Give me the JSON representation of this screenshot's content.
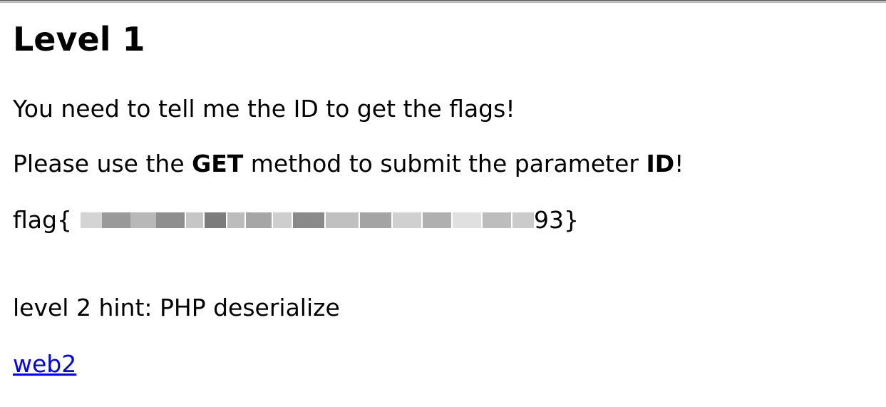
{
  "heading": "Level 1",
  "intro": "You need to tell me the ID to get the flags!",
  "instruction": {
    "prefix": "Please use the ",
    "method": "GET",
    "middle": " method to submit the parameter ",
    "param": "ID",
    "suffix": "!"
  },
  "flag": {
    "prefix": "flag{",
    "suffix": "93}"
  },
  "hint": "level 2 hint: PHP deserialize",
  "link_label": "web2",
  "colors": {
    "link": "#0000ee",
    "text": "#000000"
  }
}
